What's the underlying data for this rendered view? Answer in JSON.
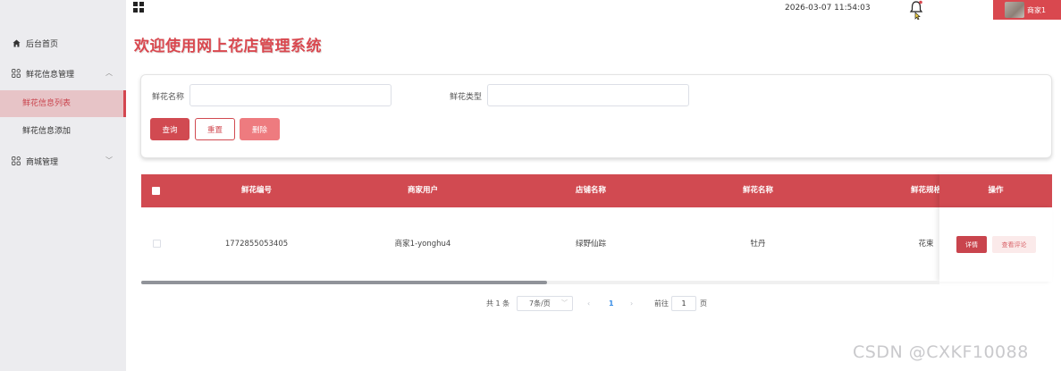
{
  "top": {
    "datetime": "2026-03-07 11:54:03",
    "user_name": "商家1"
  },
  "page_title": "欢迎使用网上花店管理系统",
  "sidebar": {
    "home": "后台首页",
    "flower_info": "鲜花信息管理",
    "flower_list": "鲜花信息列表",
    "flower_add": "鲜花信息添加",
    "mall": "商城管理"
  },
  "search": {
    "name_label": "鲜花名称",
    "name_value": "",
    "type_label": "鲜花类型",
    "type_value": "",
    "query": "查询",
    "reset": "重置",
    "delete": "删除"
  },
  "table": {
    "headers": [
      "鲜花编号",
      "商家用户",
      "店铺名称",
      "鲜花名称",
      "鲜花规格",
      "操作"
    ],
    "rows": [
      {
        "id": "1772855053405",
        "merchant": "商家1-yonghu4",
        "shop": "绿野仙踪",
        "name": "牡丹",
        "spec": "花束"
      }
    ],
    "detail": "详情",
    "comment": "查看评论"
  },
  "pagination": {
    "total": "共 1 条",
    "page_size": "7条/页",
    "current": "1",
    "goto_prefix": "前往",
    "goto_value": "1",
    "goto_suffix": "页"
  },
  "watermark": "CSDN @CXKF10088",
  "colors": {
    "accent": "#d14a51",
    "sidebar": "#ececef",
    "active_item_bg": "#e7c4c7"
  }
}
